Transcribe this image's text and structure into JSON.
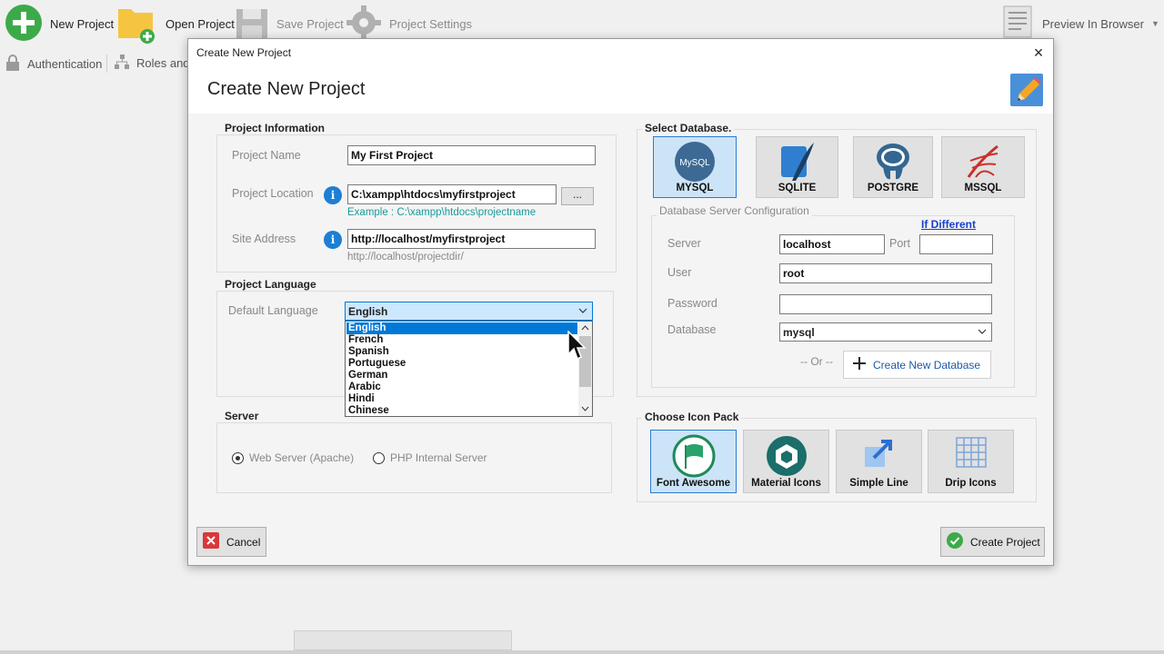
{
  "toolbar": {
    "new_project": "New Project",
    "open_project": "Open Project",
    "save_project": "Save Project",
    "project_settings": "Project Settings",
    "preview": "Preview In Browser"
  },
  "subbar": {
    "authentication": "Authentication",
    "roles": "Roles and P"
  },
  "dialog": {
    "window_title": "Create New Project",
    "heading": "Create New Project",
    "close": "×",
    "project_info": {
      "title": "Project Information",
      "name_label": "Project Name",
      "name_value": "My First Project",
      "location_label": "Project Location",
      "location_value": "C:\\xampp\\htdocs\\myfirstproject",
      "browse_label": "...",
      "location_example": "Example : C:\\xampp\\htdocs\\projectname",
      "site_label": "Site Address",
      "site_value": "http://localhost/myfirstproject",
      "site_hint": "http://localhost/projectdir/"
    },
    "language": {
      "title": "Project Language",
      "default_label": "Default Language",
      "selected": "English",
      "options": [
        "English",
        "French",
        "Spanish",
        "Portuguese",
        "German",
        "Arabic",
        "Hindi",
        "Chinese"
      ]
    },
    "server": {
      "title": "Server",
      "web_server": "Web Server (Apache)",
      "php_server": "PHP Internal Server"
    },
    "database": {
      "title": "Select Database.",
      "options": [
        "MYSQL",
        "SQLITE",
        "POSTGRE",
        "MSSQL"
      ],
      "config_title": "Database Server Configuration",
      "if_different": "If Different",
      "server_label": "Server",
      "server_value": "localhost",
      "port_label": "Port",
      "port_value": "",
      "user_label": "User",
      "user_value": "root",
      "password_label": "Password",
      "password_value": "",
      "database_label": "Database",
      "database_value": "mysql",
      "or_label": "-- Or --",
      "create_db": "Create New Database"
    },
    "icon_pack": {
      "title": "Choose Icon Pack",
      "options": [
        "Font Awesome",
        "Material Icons",
        "Simple Line",
        "Drip Icons"
      ]
    },
    "cancel": "Cancel",
    "create": "Create Project"
  },
  "colors": {
    "accent": "#0078d7",
    "link": "#1a3fc9",
    "hint_green": "#1a9a9a",
    "new_green": "#3daa4a",
    "folder_yellow": "#f5c542"
  }
}
